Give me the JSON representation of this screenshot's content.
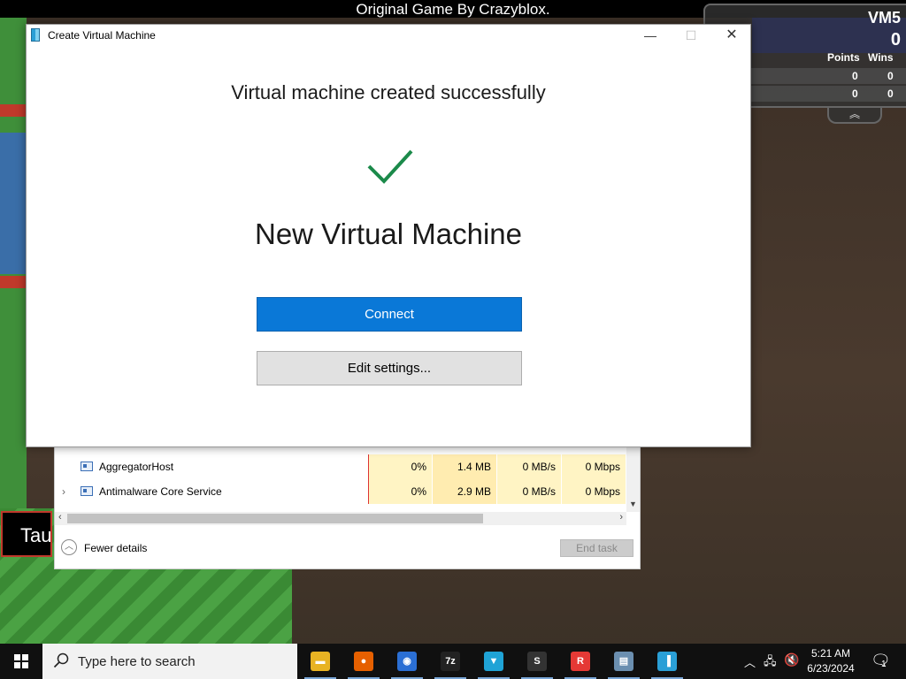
{
  "game": {
    "title": "Original Game By Crazyblox.",
    "tag_text": "Tau",
    "leaderboard": {
      "player": "VM5",
      "score": "0",
      "columns": [
        "Points",
        "Wins"
      ],
      "rows": [
        [
          "0",
          "0"
        ],
        [
          "0",
          "0"
        ]
      ]
    }
  },
  "task_manager": {
    "rows": [
      {
        "name": "AggregatorHost",
        "expand": "",
        "cpu": "0%",
        "memory": "1.4 MB",
        "disk": "0 MB/s",
        "network": "0 Mbps"
      },
      {
        "name": "Antimalware Core Service",
        "expand": "›",
        "cpu": "0%",
        "memory": "2.9 MB",
        "disk": "0 MB/s",
        "network": "0 Mbps"
      }
    ],
    "fewer_details": "Fewer details",
    "end_task": "End task"
  },
  "dialog": {
    "window_title": "Create Virtual Machine",
    "headline": "Virtual machine created successfully",
    "vm_name": "New Virtual Machine",
    "connect_label": "Connect",
    "edit_settings_label": "Edit settings...",
    "check_color": "#1b8a4a",
    "accent_color": "#0a78d7"
  },
  "taskbar": {
    "search_placeholder": "Type here to search",
    "apps": [
      {
        "name": "file-explorer",
        "glyph": "▬",
        "color": "#e8b323"
      },
      {
        "name": "firefox",
        "glyph": "●",
        "color": "#e66000"
      },
      {
        "name": "chrome",
        "glyph": "◉",
        "color": "#2b6fd4"
      },
      {
        "name": "7-zip",
        "glyph": "7z",
        "color": "#222222"
      },
      {
        "name": "vpn",
        "glyph": "▼",
        "color": "#1fa3d6"
      },
      {
        "name": "app-s",
        "glyph": "S",
        "color": "#333333"
      },
      {
        "name": "roblox",
        "glyph": "R",
        "color": "#e53935"
      },
      {
        "name": "remote-desktop",
        "glyph": "▤",
        "color": "#6b8fb0"
      },
      {
        "name": "hyper-v-quick-create",
        "glyph": "▐",
        "color": "#2a9fd6"
      }
    ],
    "time": "5:21 AM",
    "date": "6/23/2024",
    "notification_count": "1"
  }
}
